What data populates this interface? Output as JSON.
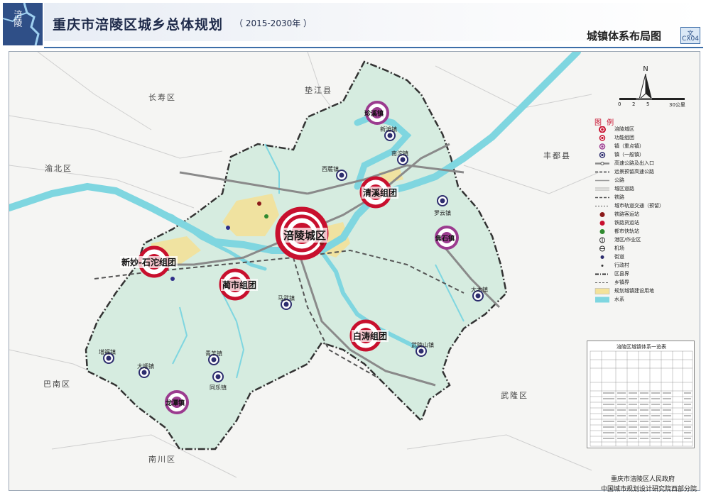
{
  "header": {
    "logo_text": "涪陵",
    "title": "重庆市涪陵区城乡总体规划",
    "year_range": "（ 2015-2030年 ）",
    "map_name": "城镇体系布局图",
    "map_code_a": "文",
    "map_code_b": "CX04"
  },
  "surrounding_areas": {
    "dianjiang": "垫江县",
    "changshou": "长寿区",
    "yubei": "渝北区",
    "fengdu": "丰都县",
    "banan": "巴南区",
    "wulong": "武隆区",
    "nanchuan": "南川区"
  },
  "clusters": {
    "fuling": "涪陵城区",
    "qingxi": "清溪组团",
    "xinmiao": "新妙-石沱组团",
    "lishi": "蔺市组团",
    "baitao": "白涛组团"
  },
  "key_towns": {
    "zhenxi": "珍溪镇",
    "jiaoshi": "焦石镇",
    "longtan": "龙潭镇"
  },
  "general_towns": {
    "xiqin": "西麓镇",
    "nantuo": "南沱镇",
    "luoyun": "罗云镇",
    "mafang": "马武镇",
    "damu": "大木镇",
    "wulingshan": "武陵山镇",
    "qingyang": "青羊镇",
    "tongle": "同乐镇",
    "dashun": "大顺镇",
    "zengfu": "增福镇",
    "xintan": "新滩镇"
  },
  "compass": {
    "north": "N"
  },
  "scale": {
    "tick_0": "0",
    "tick_2": "2",
    "tick_5": "5",
    "tick_30": "30公里"
  },
  "legend": {
    "title": "图  例",
    "items": [
      "涪陵城区",
      "功能组团",
      "镇（重点镇）",
      "镇（一般镇）",
      "高速公路及出入口",
      "远景预留高速公路",
      "公路",
      "城区道路",
      "铁路",
      "城市轨道交通（预留）",
      "铁路客运站",
      "铁路货运站",
      "都市快轨站",
      "港区/作业区",
      "机场",
      "街道",
      "行政村",
      "区县界",
      "乡镇界",
      "规划城镇建设用地",
      "水系"
    ]
  },
  "table": {
    "title": "涪陵区城镇体系一览表"
  },
  "footer": {
    "line1": "重庆市涪陵区人民政府",
    "line2": "中国城市规划设计研究院西部分院"
  },
  "colors": {
    "river": "#7fd6e0",
    "district_fill": "#d6ece0",
    "urban_fill": "#f3e29a",
    "cluster_red": "#c8102e",
    "key_town_purple": "#9b3b8f",
    "general_town_navy": "#2d2d6e",
    "boundary": "#333333"
  }
}
